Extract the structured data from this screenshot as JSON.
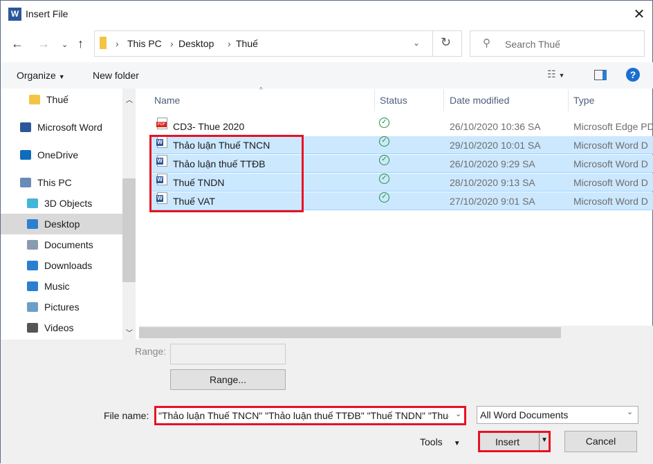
{
  "window": {
    "title": "Insert File",
    "app_icon": "W"
  },
  "nav": {
    "breadcrumb": [
      "This PC",
      "Desktop",
      "Thuế"
    ],
    "search_placeholder": "Search Thuế"
  },
  "toolbar": {
    "organize": "Organize",
    "new_folder": "New folder"
  },
  "sidebar": {
    "items": [
      {
        "label": "Thuế",
        "icon": "folder-icon",
        "color": "#f4c542"
      },
      {
        "label": "Microsoft Word",
        "icon": "word-icon",
        "color": "#2b579a"
      },
      {
        "label": "OneDrive",
        "icon": "cloud-icon",
        "color": "#0f6cbd"
      },
      {
        "label": "This PC",
        "icon": "computer-icon",
        "color": "#6a8bb5"
      },
      {
        "label": "3D Objects",
        "icon": "cube-icon",
        "color": "#43b5d9"
      },
      {
        "label": "Desktop",
        "icon": "desktop-icon",
        "color": "#2b7fd1"
      },
      {
        "label": "Documents",
        "icon": "documents-icon",
        "color": "#8a9bb0"
      },
      {
        "label": "Downloads",
        "icon": "download-icon",
        "color": "#2b7fd1"
      },
      {
        "label": "Music",
        "icon": "music-icon",
        "color": "#2b7fd1"
      },
      {
        "label": "Pictures",
        "icon": "pictures-icon",
        "color": "#6aa0c8"
      },
      {
        "label": "Videos",
        "icon": "videos-icon",
        "color": "#555"
      }
    ]
  },
  "columns": {
    "name": "Name",
    "status": "Status",
    "date": "Date modified",
    "type": "Type"
  },
  "files": [
    {
      "name": "CD3- Thue  2020",
      "date": "26/10/2020 10:36 SA",
      "type": "Microsoft Edge PDF",
      "kind": "pdf",
      "selected": false
    },
    {
      "name": "Thảo luận Thuế TNCN",
      "date": "29/10/2020 10:01 SA",
      "type": "Microsoft Word D",
      "kind": "word",
      "selected": true
    },
    {
      "name": "Thảo luận thuế TTĐB",
      "date": "26/10/2020 9:29 SA",
      "type": "Microsoft Word D",
      "kind": "word",
      "selected": true
    },
    {
      "name": "Thuế TNDN",
      "date": "28/10/2020 9:13 SA",
      "type": "Microsoft Word D",
      "kind": "word",
      "selected": true
    },
    {
      "name": "Thuế VAT",
      "date": "27/10/2020 9:01 SA",
      "type": "Microsoft Word D",
      "kind": "word",
      "selected": true
    }
  ],
  "range": {
    "label": "Range:",
    "value": "",
    "button": "Range..."
  },
  "footer": {
    "file_name_label": "File name:",
    "file_name_value": "\"Thảo luận Thuế TNCN\" \"Thảo luận thuế TTĐB\" \"Thuế TNDN\" \"Thuế VAT\"",
    "file_type": "All Word Documents",
    "tools": "Tools",
    "insert": "Insert",
    "cancel": "Cancel"
  },
  "colors": {
    "highlight": "#e81123",
    "selection": "#cce8ff"
  }
}
